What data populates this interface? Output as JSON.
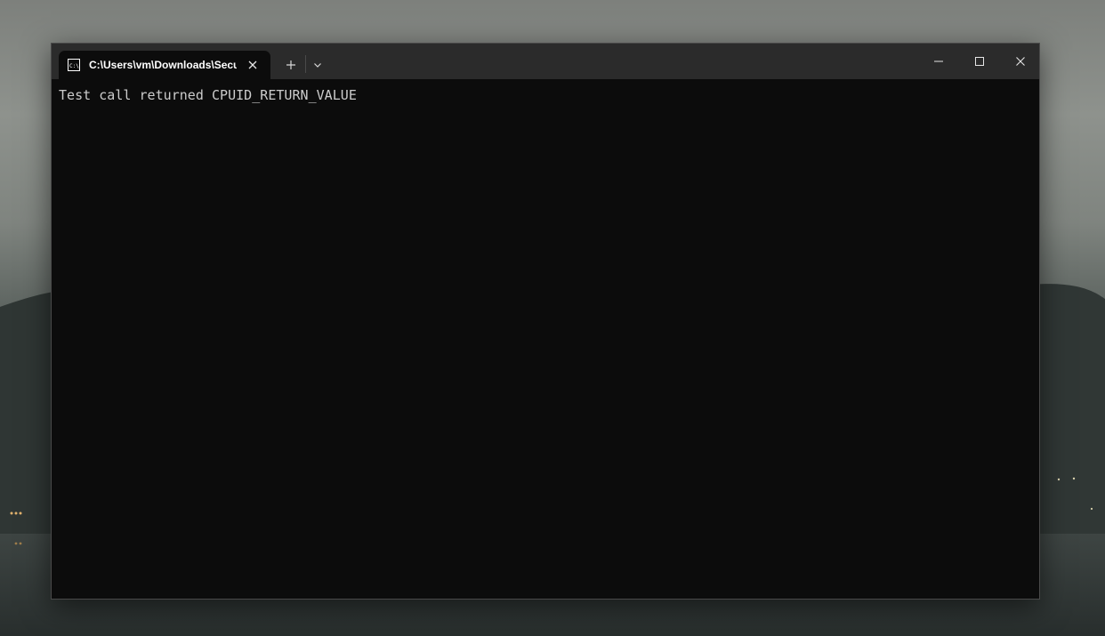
{
  "window": {
    "tab_title": "C:\\Users\\vm\\Downloads\\Secu",
    "tab_icon": "command-prompt-icon",
    "controls": {
      "new_tab_icon": "plus-icon",
      "dropdown_icon": "chevron-down-icon",
      "minimize_icon": "minimize-icon",
      "maximize_icon": "maximize-icon",
      "close_icon": "close-icon"
    }
  },
  "terminal": {
    "lines": [
      "Test call returned CPUID_RETURN_VALUE"
    ]
  },
  "colors": {
    "terminal_background": "#0c0c0c",
    "titlebar_background": "#2b2b2b",
    "text": "#cccccc",
    "tab_text": "#ffffff"
  }
}
